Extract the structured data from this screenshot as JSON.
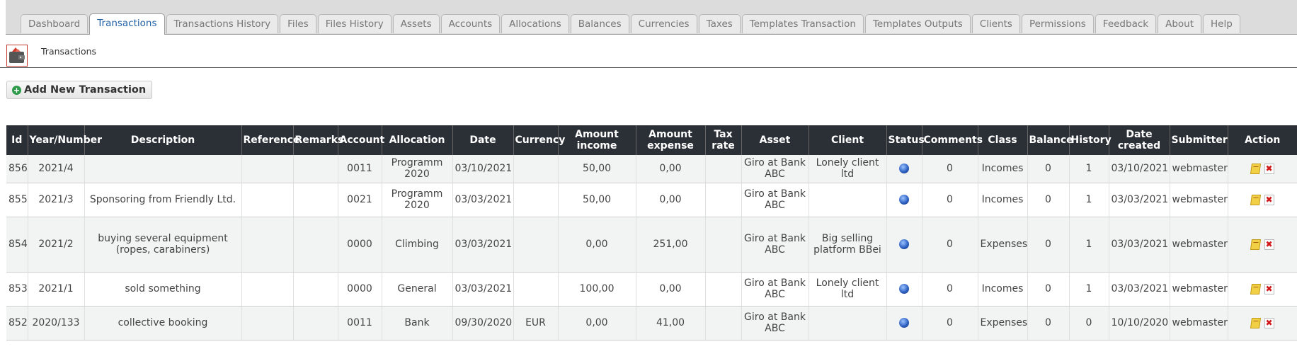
{
  "tabs": [
    "Dashboard",
    "Transactions",
    "Transactions History",
    "Files",
    "Files History",
    "Assets",
    "Accounts",
    "Allocations",
    "Balances",
    "Currencies",
    "Taxes",
    "Templates Transaction",
    "Templates Outputs",
    "Clients",
    "Permissions",
    "Feedback",
    "About",
    "Help"
  ],
  "active_tab": "Transactions",
  "page": {
    "title": "Transactions"
  },
  "toolbar": {
    "add_label": "Add New Transaction"
  },
  "table": {
    "columns": [
      "Id",
      "Year/Number",
      "Description",
      "Reference",
      "Remarks",
      "Account",
      "Allocation",
      "Date",
      "Currency",
      "Amount income",
      "Amount expense",
      "Tax rate",
      "Asset",
      "Client",
      "Status",
      "Comments",
      "Class",
      "Balance",
      "History",
      "Date created",
      "Submitter",
      "Action"
    ],
    "rows": [
      {
        "id": "856",
        "number": "2021/4",
        "description": "",
        "reference": "",
        "remarks": "",
        "account": "0011",
        "allocation": "Programm 2020",
        "date": "03/10/2021",
        "currency": "",
        "income": "50,00",
        "expense": "0,00",
        "tax": "",
        "asset": "Giro at Bank ABC",
        "client": "Lonely client ltd",
        "comments": "0",
        "class": "Incomes",
        "balance": "0",
        "history": "1",
        "created": "03/10/2021",
        "submitter": "webmaster"
      },
      {
        "id": "855",
        "number": "2021/3",
        "description": "Sponsoring from Friendly Ltd.",
        "reference": "",
        "remarks": "",
        "account": "0021",
        "allocation": "Programm 2020",
        "date": "03/03/2021",
        "currency": "",
        "income": "50,00",
        "expense": "0,00",
        "tax": "",
        "asset": "Giro at Bank ABC",
        "client": "",
        "comments": "0",
        "class": "Incomes",
        "balance": "0",
        "history": "1",
        "created": "03/03/2021",
        "submitter": "webmaster"
      },
      {
        "id": "854",
        "number": "2021/2",
        "description": "buying several equipment (ropes, carabiners)",
        "reference": "",
        "remarks": "",
        "account": "0000",
        "allocation": "Climbing",
        "date": "03/03/2021",
        "currency": "",
        "income": "0,00",
        "expense": "251,00",
        "tax": "",
        "asset": "Giro at Bank ABC",
        "client": "Big selling platform BBei",
        "comments": "0",
        "class": "Expenses",
        "balance": "0",
        "history": "1",
        "created": "03/03/2021",
        "submitter": "webmaster"
      },
      {
        "id": "853",
        "number": "2021/1",
        "description": "sold something",
        "reference": "",
        "remarks": "",
        "account": "0000",
        "allocation": "General",
        "date": "03/03/2021",
        "currency": "",
        "income": "100,00",
        "expense": "0,00",
        "tax": "",
        "asset": "Giro at Bank ABC",
        "client": "Lonely client ltd",
        "comments": "0",
        "class": "Incomes",
        "balance": "0",
        "history": "1",
        "created": "03/03/2021",
        "submitter": "webmaster"
      },
      {
        "id": "852",
        "number": "2020/133",
        "description": "collective booking",
        "reference": "",
        "remarks": "",
        "account": "0011",
        "allocation": "Bank",
        "date": "09/30/2020",
        "currency": "EUR",
        "income": "0,00",
        "expense": "41,00",
        "tax": "",
        "asset": "Giro at Bank ABC",
        "client": "",
        "comments": "0",
        "class": "Expenses",
        "balance": "0",
        "history": "0",
        "created": "10/10/2020",
        "submitter": "webmaster"
      }
    ]
  },
  "icons": {
    "status": "globe-icon",
    "edit": "edit-icon",
    "delete": "delete-icon",
    "header": "wallet-icon",
    "add": "add-icon"
  }
}
